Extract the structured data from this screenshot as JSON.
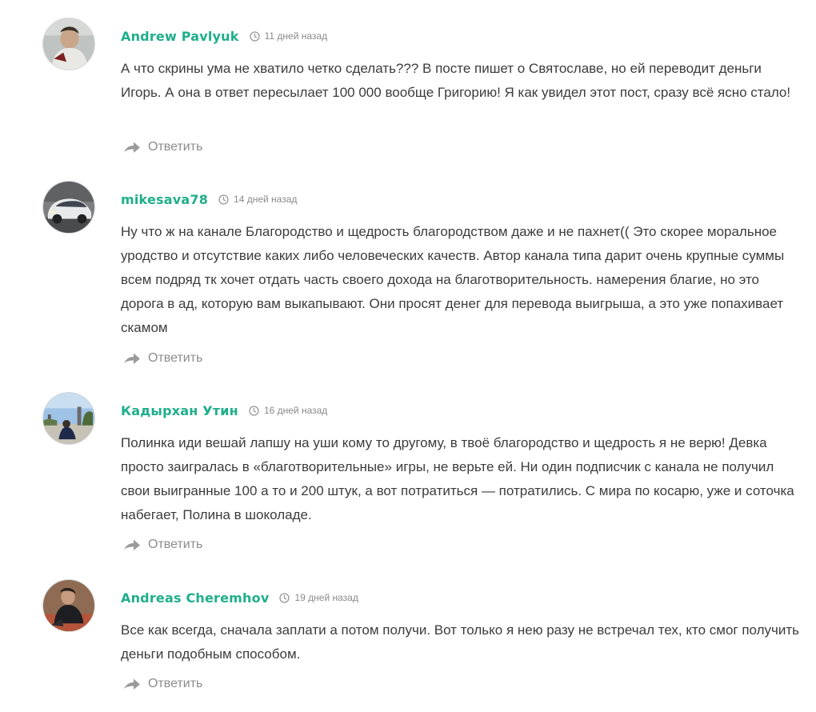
{
  "comments": [
    {
      "author": "Andrew Pavlyuk",
      "date": "11 дней назад",
      "text": "А что скрины ума не хватило четко сделать??? В посте пишет о Святославе, но ей переводит деньги Игорь. А она в ответ пересылает 100 000 вообще Григорию! Я как увидел этот пост, сразу всё ясно стало!",
      "reply_label": "Ответить",
      "avatar_icon": "user-photo-icon"
    },
    {
      "author": "mikesava78",
      "date": "14 дней назад",
      "text": "Ну что ж на канале Благородство и щедрость благородством даже и не пахнет(( Это скорее моральное уродство и отсутствие каких либо человеческих качеств. Автор канала типа дарит очень крупные суммы всем подряд тк хочет отдать часть своего дохода на благотворительность. намерения благие, но это дорога в ад, которую вам выкапывают. Они просят денег для перевода выигрыша, а это уже попахивает скамом",
      "reply_label": "Ответить",
      "avatar_icon": "car-photo-icon"
    },
    {
      "author": "Кадырхан Утин",
      "date": "16 дней назад",
      "text": "Полинка иди вешай лапшу на уши кому то другому, в твоё благородство и щедрость я не верю! Девка просто заигралась в «благотворительные» игры, не верьте ей. Ни один подписчик с канала не получил свои выигранные 100 а то и 200 штук, а вот потратиться — потратились. С мира по косарю, уже и соточка набегает, Полина в шоколаде.",
      "reply_label": "Ответить",
      "avatar_icon": "landscape-photo-icon"
    },
    {
      "author": "Andreas Cheremhov",
      "date": "19 дней назад",
      "text": "Все как всегда, сначала заплати а потом получи. Вот только я нею разу не встречал тех, кто смог получить деньги подобным способом.",
      "reply_label": "Ответить",
      "avatar_icon": "user-photo-icon"
    }
  ],
  "colors": {
    "author": "#1fae8b",
    "date": "#8a8a8a",
    "text": "#3c3c3c",
    "reply": "#8c8c8c"
  }
}
